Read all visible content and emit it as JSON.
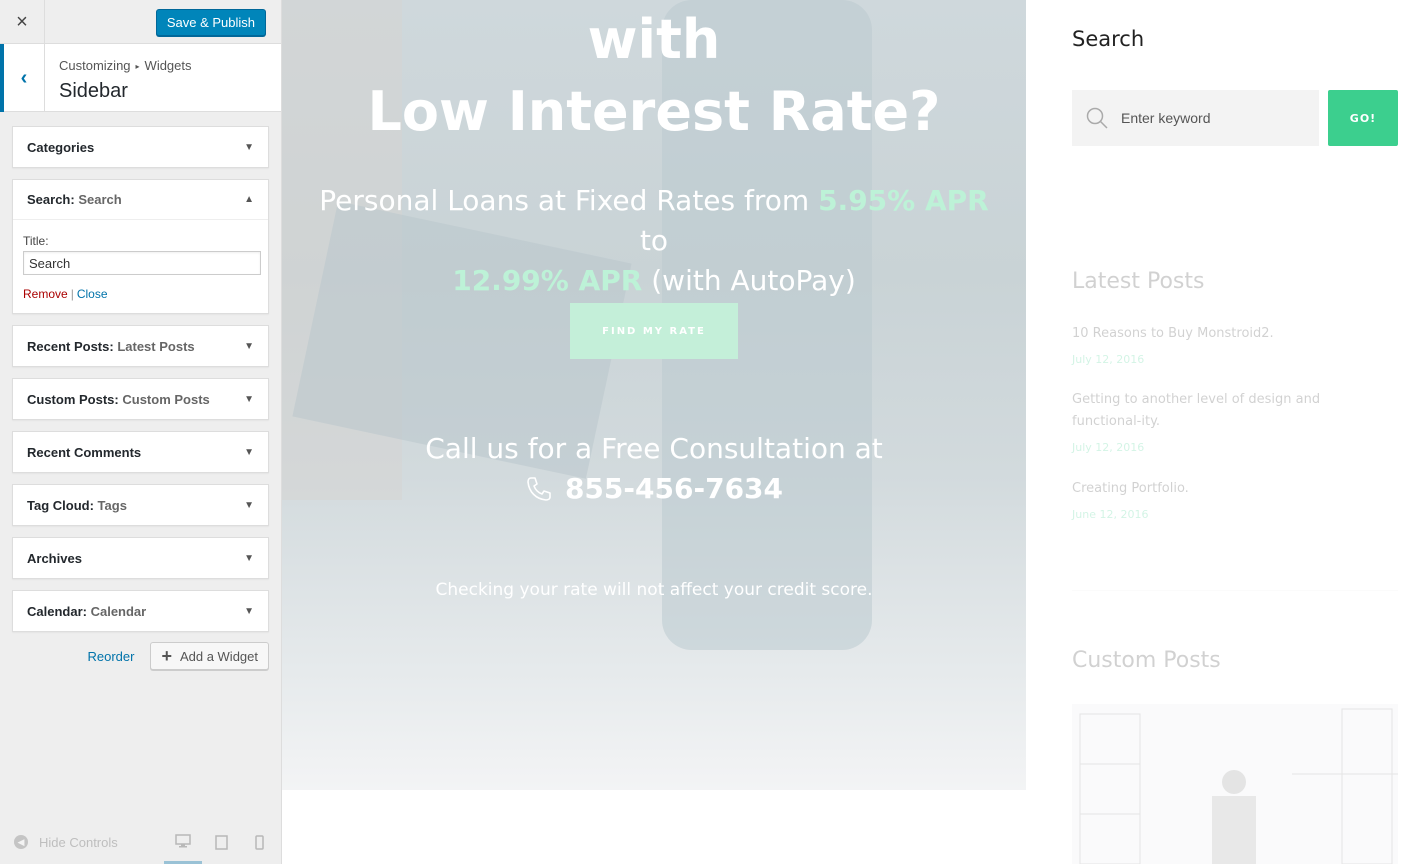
{
  "customizer": {
    "close_icon": "×",
    "save_label": "Save & Publish",
    "breadcrumb": [
      "Customizing",
      "Widgets"
    ],
    "breadcrumb_sep": "▸",
    "section_title": "Sidebar",
    "widgets": [
      {
        "name": "Categories",
        "title": ""
      },
      {
        "name": "Search",
        "title": "Search",
        "open": true
      },
      {
        "name": "Recent Posts",
        "title": "Latest Posts"
      },
      {
        "name": "Custom Posts",
        "title": "Custom Posts"
      },
      {
        "name": "Recent Comments",
        "title": ""
      },
      {
        "name": "Tag Cloud",
        "title": "Tags"
      },
      {
        "name": "Archives",
        "title": ""
      },
      {
        "name": "Calendar",
        "title": "Calendar"
      }
    ],
    "search_form": {
      "title_label": "Title:",
      "title_value": "Search",
      "remove_label": "Remove",
      "close_label": "Close"
    },
    "reorder_label": "Reorder",
    "add_widget_label": "Add a Widget",
    "hide_controls_label": "Hide Controls"
  },
  "hero": {
    "line1": "with",
    "line2": "Low Interest Rate?",
    "sub_part1": "Personal Loans at Fixed Rates from ",
    "apr_low": "5.95% APR",
    "sub_part2": " to",
    "apr_high": "12.99% APR",
    "sub_part3": " (with AutoPay)",
    "cta_label": "FIND MY RATE",
    "call_text": "Call us for a Free Consultation at",
    "phone": "855-456-7634",
    "note": "Checking your rate will not affect your credit score."
  },
  "right_sidebar": {
    "search_title": "Search",
    "search_placeholder": "Enter keyword",
    "go_label": "GO!",
    "latest_title": "Latest Posts",
    "posts": [
      {
        "title": "10 Reasons to Buy Monstroid2.",
        "date": "July 12, 2016"
      },
      {
        "title": "Getting to another level of design and functional-ity.",
        "date": "July 12, 2016"
      },
      {
        "title": "Creating Portfolio.",
        "date": "June 12, 2016"
      }
    ],
    "custom_title": "Custom Posts"
  },
  "colors": {
    "wp_blue": "#0085ba",
    "accent_green": "#3ccf8e",
    "remove_red": "#aa0000"
  }
}
